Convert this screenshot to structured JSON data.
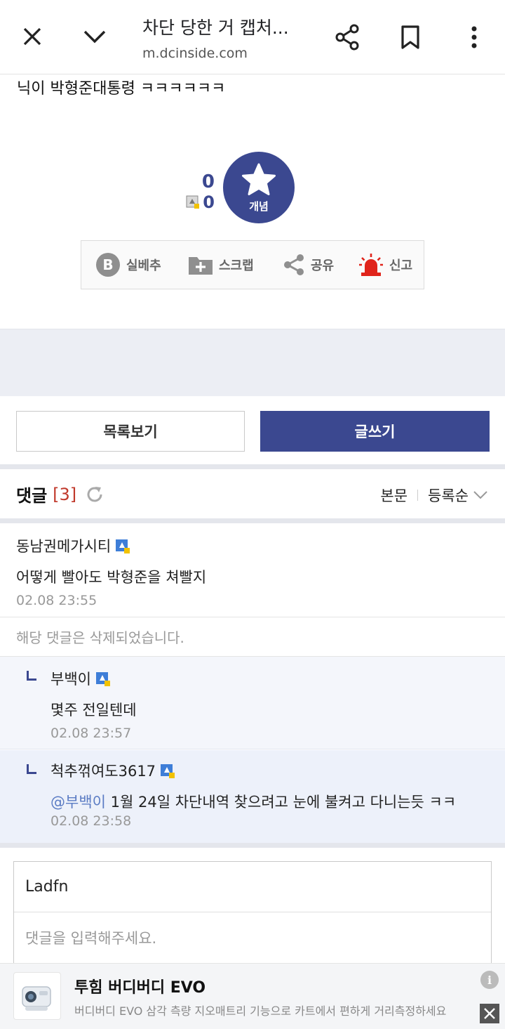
{
  "browser": {
    "title": "차단 당한 거 캡처...",
    "url": "m.dcinside.com",
    "icons": [
      "close-icon",
      "chevron-down-icon",
      "share-icon",
      "bookmark-icon",
      "more-vert-icon"
    ]
  },
  "post": {
    "tail_text": "닉이 박형준대통령 ㅋㅋㅋㅋㅋㅋ"
  },
  "recommend": {
    "up_count": "0",
    "fixed_count": "0",
    "button_label": "개념"
  },
  "actions": {
    "items": [
      {
        "label": "실베추",
        "icon": "best-b-icon"
      },
      {
        "label": "스크랩",
        "icon": "folder-plus-icon"
      },
      {
        "label": "공유",
        "icon": "share-icon"
      },
      {
        "label": "신고",
        "icon": "siren-icon"
      }
    ]
  },
  "nav": {
    "list_label": "목록보기",
    "write_label": "글쓰기"
  },
  "comments_header": {
    "title": "댓글",
    "count": "[3]",
    "sort_body": "본문",
    "sort_order": "등록순"
  },
  "comments": [
    {
      "nick": "동남권메가시티",
      "text": "어떻게 빨아도 박형준을 쳐빨지",
      "date": "02.08 23:55"
    },
    {
      "deleted_text": "해당 댓글은 삭제되었습니다."
    },
    {
      "nick": "부백이",
      "text": "몇주 전일텐데",
      "date": "02.08 23:57"
    },
    {
      "nick": "척추꺾여도3617",
      "mention": "@부백이",
      "text": "1월 24일 차단내역 찾으려고 눈에 불켜고 다니는듯 ㅋㅋ",
      "date": "02.08 23:58"
    }
  ],
  "comment_form": {
    "nick_value": "Ladfn",
    "placeholder": "댓글을 입력해주세요."
  },
  "ad": {
    "title": "투힘 버디버디 EVO",
    "description": "버디버디 EVO 삼각 측량 지오매트리 기능으로 카트에서 편하게 거리측정하세요"
  },
  "colors": {
    "brand": "#3b4890",
    "count_red": "#c0392b",
    "mention_blue": "#5b7cc4",
    "siren_red": "#e0241b"
  }
}
